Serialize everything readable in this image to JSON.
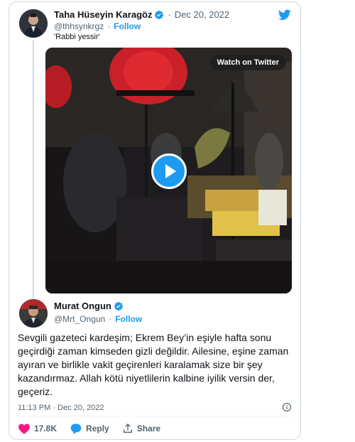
{
  "quoted_tweet": {
    "author_name": "Taha Hüseyin Karagöz",
    "separator": "·",
    "date": "Dec 20, 2022",
    "handle": "@thhsynkrgz",
    "follow_sep": "·",
    "follow_label": "Follow",
    "text": "'Rabbi yessir'",
    "video": {
      "watch_label": "Watch on Twitter"
    }
  },
  "tweet": {
    "author_name": "Murat Ongun",
    "handle": "@Mrt_Ongun",
    "follow_sep": "·",
    "follow_label": "Follow",
    "text": "Sevgili gazeteci kardeşim; Ekrem Bey’in eşiyle hafta sonu geçirdiği zaman kimseden gizli değildir. Ailesine, eşine zaman ayıran ve birlikle vakit geçirenleri karalamak size bir şey kazandırmaz. Allah kötü niyetlilerin kalbine iyilik versin der, geçeriz.",
    "timestamp": "11:13 PM · Dec 20, 2022"
  },
  "actions": {
    "like_count": "17.8K",
    "reply_label": "Reply",
    "share_label": "Share"
  },
  "colors": {
    "accent": "#1d9bf0",
    "like_red": "#f91880",
    "text_primary": "#0f1419",
    "text_secondary": "#536471"
  },
  "icons": [
    "twitter-logo-icon",
    "verified-badge-icon",
    "play-icon",
    "info-icon",
    "heart-icon",
    "reply-icon",
    "share-icon"
  ]
}
